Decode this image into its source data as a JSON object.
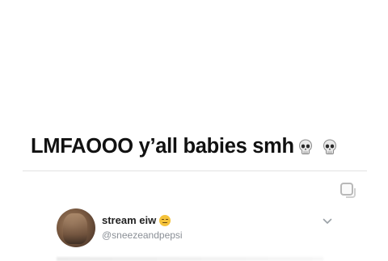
{
  "caption": {
    "text": "LMFAOOO y’all babies smh",
    "trailing_icons": [
      "skull-icon",
      "skull-icon"
    ]
  },
  "tweet": {
    "display_name": "stream eiw",
    "display_name_emoji": "smirk-face-icon",
    "handle": "@sneezeandpepsi",
    "menu_icon": "chevron-down-icon"
  },
  "controls": {
    "corner_icon": "copy-square-icon"
  },
  "colors": {
    "text": "#111111",
    "handle": "#8a8f96",
    "divider": "#e3e3e3"
  }
}
